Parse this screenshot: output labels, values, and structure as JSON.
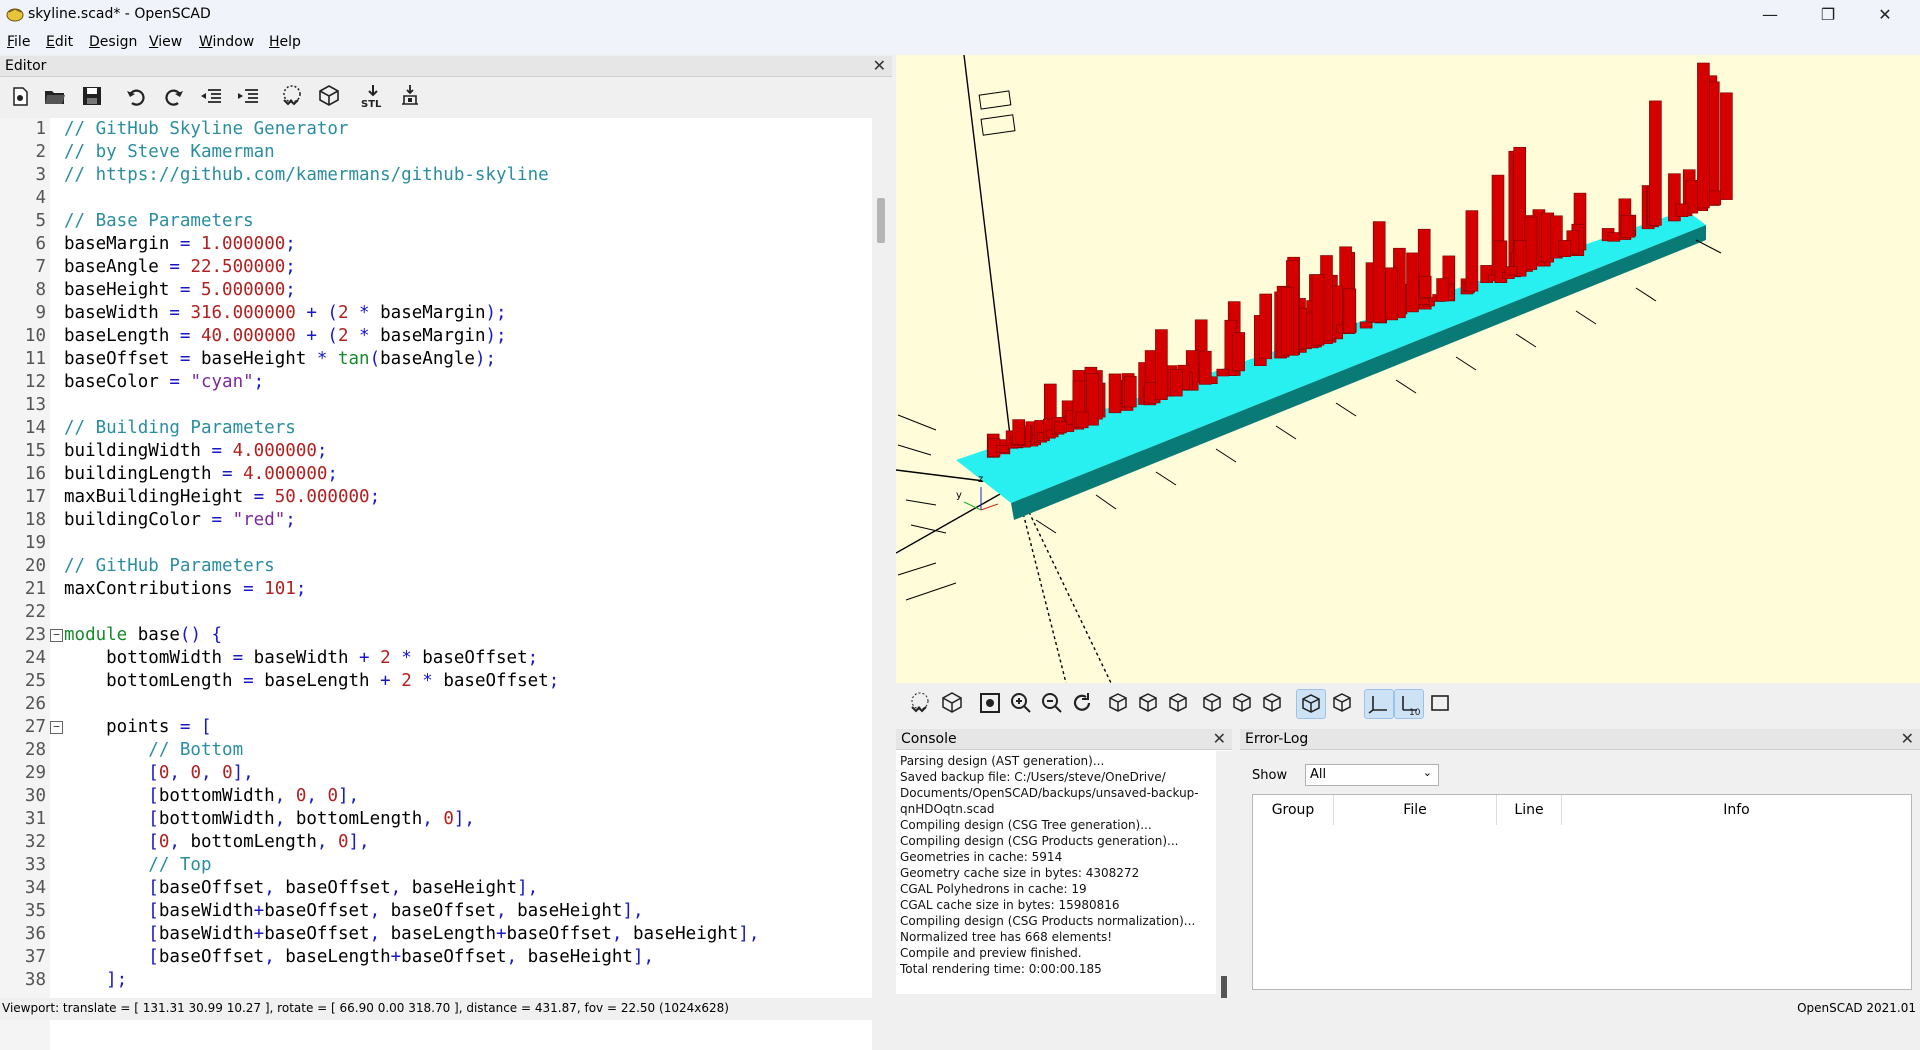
{
  "window": {
    "title": "skyline.scad* - OpenSCAD",
    "minimize": "—",
    "maximize": "❐",
    "close": "✕"
  },
  "menu": [
    "File",
    "Edit",
    "Design",
    "View",
    "Window",
    "Help"
  ],
  "editor": {
    "title": "Editor",
    "toolbar_icons": [
      "new-file-icon",
      "open-folder-icon",
      "save-icon",
      "undo-icon",
      "redo-icon",
      "unindent-icon",
      "indent-icon",
      "preview-icon",
      "render-icon",
      "export-stl-icon",
      "send-to-print-icon"
    ],
    "stl_label": "STL",
    "lines": [
      {
        "n": "1",
        "t": [
          [
            "c-cm",
            "// GitHub Skyline Generator"
          ]
        ]
      },
      {
        "n": "2",
        "t": [
          [
            "c-cm",
            "// by Steve Kamerman"
          ]
        ]
      },
      {
        "n": "3",
        "t": [
          [
            "c-cm",
            "// https://github.com/kamermans/github-skyline"
          ]
        ]
      },
      {
        "n": "4",
        "t": []
      },
      {
        "n": "5",
        "t": [
          [
            "c-cm",
            "// Base Parameters"
          ]
        ]
      },
      {
        "n": "6",
        "t": [
          [
            "",
            "baseMargin "
          ],
          [
            "c-op",
            "="
          ],
          [
            "c-num",
            " 1.000000"
          ],
          [
            "c-op",
            ";"
          ]
        ]
      },
      {
        "n": "7",
        "t": [
          [
            "",
            "baseAngle "
          ],
          [
            "c-op",
            "="
          ],
          [
            "c-num",
            " 22.500000"
          ],
          [
            "c-op",
            ";"
          ]
        ]
      },
      {
        "n": "8",
        "t": [
          [
            "",
            "baseHeight "
          ],
          [
            "c-op",
            "="
          ],
          [
            "c-num",
            " 5.000000"
          ],
          [
            "c-op",
            ";"
          ]
        ]
      },
      {
        "n": "9",
        "t": [
          [
            "",
            "baseWidth "
          ],
          [
            "c-op",
            "="
          ],
          [
            "c-num",
            " 316.000000"
          ],
          [
            "c-op",
            " + ("
          ],
          [
            "c-num",
            "2"
          ],
          [
            "c-op",
            " *"
          ],
          [
            "",
            " baseMargin"
          ],
          [
            "c-op",
            ");"
          ]
        ]
      },
      {
        "n": "10",
        "t": [
          [
            "",
            "baseLength "
          ],
          [
            "c-op",
            "="
          ],
          [
            "c-num",
            " 40.000000"
          ],
          [
            "c-op",
            " + ("
          ],
          [
            "c-num",
            "2"
          ],
          [
            "c-op",
            " *"
          ],
          [
            "",
            " baseMargin"
          ],
          [
            "c-op",
            ");"
          ]
        ]
      },
      {
        "n": "11",
        "t": [
          [
            "",
            "baseOffset "
          ],
          [
            "c-op",
            "="
          ],
          [
            "",
            " baseHeight "
          ],
          [
            "c-op",
            "*"
          ],
          [
            "c-fn",
            " tan"
          ],
          [
            "c-op",
            "("
          ],
          [
            "",
            "baseAngle"
          ],
          [
            "c-op",
            ");"
          ]
        ]
      },
      {
        "n": "12",
        "t": [
          [
            "",
            "baseColor "
          ],
          [
            "c-op",
            "="
          ],
          [
            "c-str",
            " \"cyan\""
          ],
          [
            "c-op",
            ";"
          ]
        ]
      },
      {
        "n": "13",
        "t": []
      },
      {
        "n": "14",
        "t": [
          [
            "c-cm",
            "// Building Parameters"
          ]
        ]
      },
      {
        "n": "15",
        "t": [
          [
            "",
            "buildingWidth "
          ],
          [
            "c-op",
            "="
          ],
          [
            "c-num",
            " 4.000000"
          ],
          [
            "c-op",
            ";"
          ]
        ]
      },
      {
        "n": "16",
        "t": [
          [
            "",
            "buildingLength "
          ],
          [
            "c-op",
            "="
          ],
          [
            "c-num",
            " 4.000000"
          ],
          [
            "c-op",
            ";"
          ]
        ]
      },
      {
        "n": "17",
        "t": [
          [
            "",
            "maxBuildingHeight "
          ],
          [
            "c-op",
            "="
          ],
          [
            "c-num",
            " 50.000000"
          ],
          [
            "c-op",
            ";"
          ]
        ]
      },
      {
        "n": "18",
        "t": [
          [
            "",
            "buildingColor "
          ],
          [
            "c-op",
            "="
          ],
          [
            "c-str",
            " \"red\""
          ],
          [
            "c-op",
            ";"
          ]
        ]
      },
      {
        "n": "19",
        "t": []
      },
      {
        "n": "20",
        "t": [
          [
            "c-cm",
            "// GitHub Parameters"
          ]
        ]
      },
      {
        "n": "21",
        "t": [
          [
            "",
            "maxContributions "
          ],
          [
            "c-op",
            "="
          ],
          [
            "c-num",
            " 101"
          ],
          [
            "c-op",
            ";"
          ]
        ]
      },
      {
        "n": "22",
        "t": []
      },
      {
        "n": "23",
        "f": "−",
        "t": [
          [
            "c-kw",
            "module"
          ],
          [
            "",
            " base"
          ],
          [
            "c-op",
            "() {"
          ]
        ]
      },
      {
        "n": "24",
        "t": [
          [
            "",
            "    bottomWidth "
          ],
          [
            "c-op",
            "="
          ],
          [
            "",
            " baseWidth "
          ],
          [
            "c-op",
            "+"
          ],
          [
            "c-num",
            " 2"
          ],
          [
            "c-op",
            " *"
          ],
          [
            "",
            " baseOffset"
          ],
          [
            "c-op",
            ";"
          ]
        ]
      },
      {
        "n": "25",
        "t": [
          [
            "",
            "    bottomLength "
          ],
          [
            "c-op",
            "="
          ],
          [
            "",
            " baseLength "
          ],
          [
            "c-op",
            "+"
          ],
          [
            "c-num",
            " 2"
          ],
          [
            "c-op",
            " *"
          ],
          [
            "",
            " baseOffset"
          ],
          [
            "c-op",
            ";"
          ]
        ]
      },
      {
        "n": "26",
        "t": []
      },
      {
        "n": "27",
        "f": "−",
        "t": [
          [
            "",
            "    points "
          ],
          [
            "c-op",
            "= ["
          ]
        ]
      },
      {
        "n": "28",
        "t": [
          [
            "c-cm",
            "        // Bottom"
          ]
        ]
      },
      {
        "n": "29",
        "t": [
          [
            "c-op",
            "        ["
          ],
          [
            "c-num",
            "0"
          ],
          [
            "c-op",
            ", "
          ],
          [
            "c-num",
            "0"
          ],
          [
            "c-op",
            ", "
          ],
          [
            "c-num",
            "0"
          ],
          [
            "c-op",
            "],"
          ]
        ]
      },
      {
        "n": "30",
        "t": [
          [
            "c-op",
            "        ["
          ],
          [
            "",
            "bottomWidth"
          ],
          [
            "c-op",
            ", "
          ],
          [
            "c-num",
            "0"
          ],
          [
            "c-op",
            ", "
          ],
          [
            "c-num",
            "0"
          ],
          [
            "c-op",
            "],"
          ]
        ]
      },
      {
        "n": "31",
        "t": [
          [
            "c-op",
            "        ["
          ],
          [
            "",
            "bottomWidth"
          ],
          [
            "c-op",
            ", "
          ],
          [
            "",
            "bottomLength"
          ],
          [
            "c-op",
            ", "
          ],
          [
            "c-num",
            "0"
          ],
          [
            "c-op",
            "],"
          ]
        ]
      },
      {
        "n": "32",
        "t": [
          [
            "c-op",
            "        ["
          ],
          [
            "c-num",
            "0"
          ],
          [
            "c-op",
            ", "
          ],
          [
            "",
            "bottomLength"
          ],
          [
            "c-op",
            ", "
          ],
          [
            "c-num",
            "0"
          ],
          [
            "c-op",
            "],"
          ]
        ]
      },
      {
        "n": "33",
        "t": [
          [
            "c-cm",
            "        // Top"
          ]
        ]
      },
      {
        "n": "34",
        "t": [
          [
            "c-op",
            "        ["
          ],
          [
            "",
            "baseOffset"
          ],
          [
            "c-op",
            ", "
          ],
          [
            "",
            "baseOffset"
          ],
          [
            "c-op",
            ", "
          ],
          [
            "",
            "baseHeight"
          ],
          [
            "c-op",
            "],"
          ]
        ]
      },
      {
        "n": "35",
        "t": [
          [
            "c-op",
            "        ["
          ],
          [
            "",
            "baseWidth"
          ],
          [
            "c-op",
            "+"
          ],
          [
            "",
            "baseOffset"
          ],
          [
            "c-op",
            ", "
          ],
          [
            "",
            "baseOffset"
          ],
          [
            "c-op",
            ", "
          ],
          [
            "",
            "baseHeight"
          ],
          [
            "c-op",
            "],"
          ]
        ]
      },
      {
        "n": "36",
        "t": [
          [
            "c-op",
            "        ["
          ],
          [
            "",
            "baseWidth"
          ],
          [
            "c-op",
            "+"
          ],
          [
            "",
            "baseOffset"
          ],
          [
            "c-op",
            ", "
          ],
          [
            "",
            "baseLength"
          ],
          [
            "c-op",
            "+"
          ],
          [
            "",
            "baseOffset"
          ],
          [
            "c-op",
            ", "
          ],
          [
            "",
            "baseHeight"
          ],
          [
            "c-op",
            "],"
          ]
        ]
      },
      {
        "n": "37",
        "t": [
          [
            "c-op",
            "        ["
          ],
          [
            "",
            "baseOffset"
          ],
          [
            "c-op",
            ", "
          ],
          [
            "",
            "baseLength"
          ],
          [
            "c-op",
            "+"
          ],
          [
            "",
            "baseOffset"
          ],
          [
            "c-op",
            ", "
          ],
          [
            "",
            "baseHeight"
          ],
          [
            "c-op",
            "],"
          ]
        ]
      },
      {
        "n": "38",
        "t": [
          [
            "c-op",
            "    ];"
          ]
        ]
      }
    ]
  },
  "viewport": {
    "background": "#fefcd9",
    "building_color": "#d40000",
    "base_color": "#2ef0f0",
    "axis_label_z": "z",
    "axis_label_y": "y"
  },
  "view_toolbar": {
    "icons": [
      "preview-icon",
      "render-icon",
      "view-all-icon",
      "zoom-in-icon",
      "zoom-out-icon",
      "reset-view-icon",
      "view-right-icon",
      "view-top-icon",
      "view-bottom-icon",
      "view-left-icon",
      "view-front-icon",
      "view-back-icon",
      "perspective-icon",
      "orthogonal-icon",
      "show-axes-icon",
      "show-scale-markers-icon",
      "show-edges-icon"
    ],
    "scale_label": "10"
  },
  "console": {
    "title": "Console",
    "lines": [
      "Parsing design (AST generation)...",
      "Saved backup file: C:/Users/steve/OneDrive/",
      "Documents/OpenSCAD/backups/unsaved-backup-",
      "qnHDOqtn.scad",
      "Compiling design (CSG Tree generation)...",
      "Compiling design (CSG Products generation)...",
      "Geometries in cache: 5914",
      "Geometry cache size in bytes: 4308272",
      "CGAL Polyhedrons in cache: 19",
      "CGAL cache size in bytes: 15980816",
      "Compiling design (CSG Products normalization)...",
      "Normalized tree has 668 elements!",
      "Compile and preview finished.",
      "Total rendering time: 0:00:00.185"
    ]
  },
  "errorlog": {
    "title": "Error-Log",
    "show_label": "Show",
    "show_value": "All",
    "columns": [
      "Group",
      "File",
      "Line",
      "Info"
    ]
  },
  "status": {
    "left": "Viewport: translate = [ 131.31 30.99 10.27 ], rotate = [ 66.90 0.00 318.70 ], distance = 431.87, fov = 22.50 (1024x628)",
    "right": "OpenSCAD 2021.01"
  }
}
